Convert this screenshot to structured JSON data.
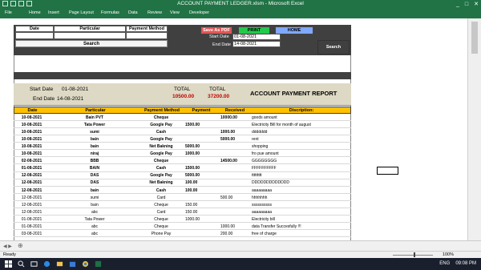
{
  "window": {
    "title": "ACCOUNT PAYMENT LEDGER.xlsm - Microsoft Excel",
    "controls": [
      "_",
      "□",
      "✕"
    ]
  },
  "ribbon": {
    "tabs": [
      "File",
      "Home",
      "Insert",
      "Page Layout",
      "Formulas",
      "Data",
      "Review",
      "View",
      "Developer"
    ]
  },
  "filter": {
    "headers": [
      "Date",
      "Particular",
      "Payment Method"
    ],
    "search_label": "Search",
    "start_label": "Start Date",
    "start_value": "01-08-2021",
    "end_label": "End Date",
    "end_value": "14-08-2021",
    "search2_label": "Search"
  },
  "buttons": {
    "pdf": "Save As PDF",
    "print": "PRINT",
    "home": "HOME"
  },
  "report": {
    "start_label": "Start Date",
    "start_value": "01-08-2021",
    "end_label": "End Date",
    "end_value": "14-08-2021",
    "total_label_1": "TOTAL",
    "total_value_1": "10500.00",
    "total_label_2": "TOTAL",
    "total_value_2": "37200.00",
    "title": "ACCOUNT PAYMENT REPORT"
  },
  "table": {
    "headers": [
      "Date",
      "Particular",
      "Payment Method",
      "Payment",
      "Received",
      "Discription:"
    ],
    "rows": [
      {
        "date": "10-08-2021",
        "part": "Bain PVT",
        "meth": "Cheque",
        "pay": "",
        "rec": "10000.00",
        "desc": "goods amount",
        "bold": true
      },
      {
        "date": "10-08-2021",
        "part": "Tata Power",
        "meth": "Google Pay",
        "pay": "1500.00",
        "rec": "",
        "desc": "Electricity Bill for month of august",
        "bold": true
      },
      {
        "date": "10-08-2021",
        "part": "sumi",
        "meth": "Cash",
        "pay": "",
        "rec": "1000.00",
        "desc": "ddddddd",
        "bold": true
      },
      {
        "date": "10-08-2021",
        "part": "bain",
        "meth": "Google Pay",
        "pay": "",
        "rec": "5000.00",
        "desc": "rent",
        "bold": true
      },
      {
        "date": "10-08-2021",
        "part": "bain",
        "meth": "Net Bakning",
        "pay": "5000.00",
        "rec": "",
        "desc": "shopping",
        "bold": true
      },
      {
        "date": "10-08-2021",
        "part": "niraj",
        "meth": "Google Pay",
        "pay": "1000.00",
        "rec": "",
        "desc": "fro pue amount",
        "bold": true
      },
      {
        "date": "02-08-2021",
        "part": "BBB",
        "meth": "Cheque",
        "pay": "",
        "rec": "14500.00",
        "desc": "GGGGGGGG",
        "bold": true
      },
      {
        "date": "01-08-2021",
        "part": "BAIN",
        "meth": "Cash",
        "pay": "1500.00",
        "rec": "",
        "desc": "FFFFFFFFFF",
        "bold": true
      },
      {
        "date": "12-08-2021",
        "part": "DAS",
        "meth": "Google Pay",
        "pay": "5000.00",
        "rec": "",
        "desc": "ttttttttt",
        "bold": true
      },
      {
        "date": "12-08-2021",
        "part": "DAS",
        "meth": "Net Bakning",
        "pay": "100.00",
        "rec": "",
        "desc": "DDDDDDDDDDDDD",
        "bold": true
      },
      {
        "date": "12-08-2021",
        "part": "bain",
        "meth": "Cash",
        "pay": "100.00",
        "rec": "",
        "desc": "aaaaaaaaa",
        "bold": true
      },
      {
        "date": "12-08-2021",
        "part": "sumi",
        "meth": "Card",
        "pay": "",
        "rec": "500.00",
        "desc": "hhhhhhh",
        "bold": false
      },
      {
        "date": "12-08-2021",
        "part": "bain",
        "meth": "Cheque",
        "pay": "150.00",
        "rec": "",
        "desc": "ssssssssss",
        "bold": false
      },
      {
        "date": "12-08-2021",
        "part": "abc",
        "meth": "Card",
        "pay": "150.00",
        "rec": "",
        "desc": "aaaaaaaaa",
        "bold": false
      },
      {
        "date": "01-08-2021",
        "part": "Tata Power",
        "meth": "Cheque",
        "pay": "1000.00",
        "rec": "",
        "desc": "Electricity bill",
        "bold": false
      },
      {
        "date": "01-08-2021",
        "part": "abc",
        "meth": "Cheque",
        "pay": "",
        "rec": "1000.00",
        "desc": "data Transfer Succesfully !!!",
        "bold": false
      },
      {
        "date": "03-08-2021",
        "part": "abc",
        "meth": "Phone Pay",
        "pay": "",
        "rec": "200.00",
        "desc": "free of charge",
        "bold": false
      }
    ]
  },
  "status": {
    "ready": "Ready",
    "zoom": "100%"
  },
  "taskbar": {
    "lang": "ENG",
    "time": "09:08 PM"
  }
}
